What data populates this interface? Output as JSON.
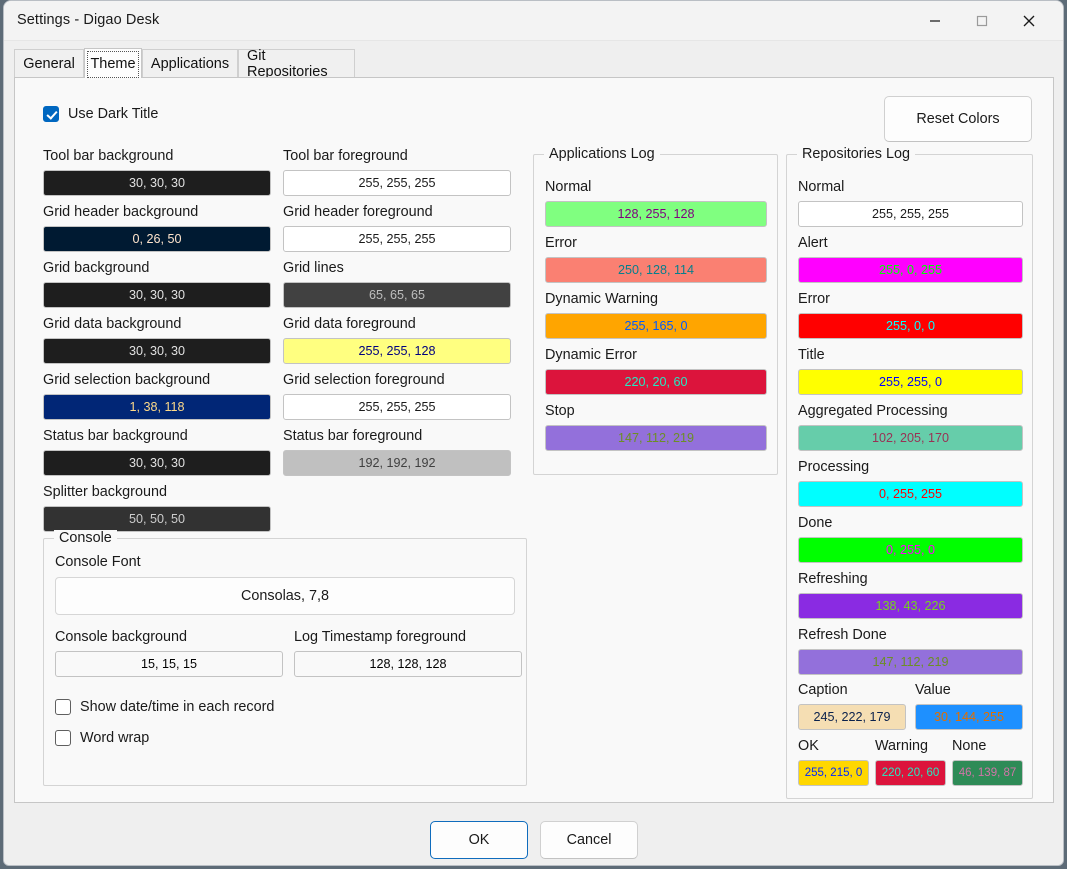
{
  "window": {
    "title": "Settings - Digao Desk",
    "controls": {
      "minimize": "minimize-icon",
      "maximize": "maximize-icon",
      "close": "close-icon"
    }
  },
  "tabs": [
    {
      "label": "General",
      "selected": false
    },
    {
      "label": "Theme",
      "selected": true
    },
    {
      "label": "Applications",
      "selected": false
    },
    {
      "label": "Git Repositories",
      "selected": false
    }
  ],
  "theme": {
    "use_dark_title": {
      "label": "Use Dark Title",
      "checked": true
    },
    "reset_colors_button": "Reset Colors",
    "column_left": [
      {
        "label": "Tool bar background",
        "value": "30, 30, 30",
        "bg": "#1e1e1e",
        "fg": "#e1e1e1"
      },
      {
        "label": "Grid header background",
        "value": "0, 26, 50",
        "bg": "#001a32",
        "fg": "#ffe5cd"
      },
      {
        "label": "Grid background",
        "value": "30, 30, 30",
        "bg": "#1e1e1e",
        "fg": "#e1e1e1"
      },
      {
        "label": "Grid data background",
        "value": "30, 30, 30",
        "bg": "#1e1e1e",
        "fg": "#e1e1e1"
      },
      {
        "label": "Grid selection background",
        "value": "1, 38, 118",
        "bg": "#012676",
        "fg": "#fed989"
      },
      {
        "label": "Status bar background",
        "value": "30, 30, 30",
        "bg": "#1e1e1e",
        "fg": "#e1e1e1"
      },
      {
        "label": "Splitter background",
        "value": "50, 50, 50",
        "bg": "#323232",
        "fg": "#cdcdcd"
      }
    ],
    "column_right": [
      {
        "label": "Tool bar foreground",
        "value": "255, 255, 255",
        "bg": "#ffffff",
        "fg": "#1a1a1a"
      },
      {
        "label": "Grid header foreground",
        "value": "255, 255, 255",
        "bg": "#ffffff",
        "fg": "#1a1a1a"
      },
      {
        "label": "Grid lines",
        "value": "65, 65, 65",
        "bg": "#414141",
        "fg": "#bebebe"
      },
      {
        "label": "Grid data foreground",
        "value": "255, 255, 128",
        "bg": "#ffff80",
        "fg": "#00007f"
      },
      {
        "label": "Grid selection foreground",
        "value": "255, 255, 255",
        "bg": "#ffffff",
        "fg": "#1a1a1a"
      },
      {
        "label": "Status bar foreground",
        "value": "192, 192, 192",
        "bg": "#c0c0c0",
        "fg": "#3f3f3f"
      }
    ],
    "console": {
      "group_title": "Console",
      "font_label": "Console Font",
      "font_value": "Consolas, 7,8",
      "background": {
        "label": "Console background",
        "value": "15, 15, 15",
        "bg": "#0f0f0f",
        "fg": "#f0f0f0"
      },
      "timestamp": {
        "label": "Log Timestamp foreground",
        "value": "128, 128, 128",
        "bg": "#808080",
        "fg": "#7f7f7f"
      },
      "show_datetime": {
        "label": "Show date/time in each record",
        "checked": false
      },
      "word_wrap": {
        "label": "Word wrap",
        "checked": false
      }
    },
    "applications_log": {
      "group_title": "Applications Log",
      "items": [
        {
          "label": "Normal",
          "value": "128, 255, 128",
          "bg": "#80ff80",
          "fg": "#7f007f"
        },
        {
          "label": "Error",
          "value": "250, 128, 114",
          "bg": "#fa8072",
          "fg": "#057f8d"
        },
        {
          "label": "Dynamic Warning",
          "value": "255, 165, 0",
          "bg": "#ffa500",
          "fg": "#005aff"
        },
        {
          "label": "Dynamic Error",
          "value": "220, 20, 60",
          "bg": "#dc143c",
          "fg": "#23ebc3"
        },
        {
          "label": "Stop",
          "value": "147, 112, 219",
          "bg": "#9370db",
          "fg": "#6c8f24"
        }
      ]
    },
    "repositories_log": {
      "group_title": "Repositories Log",
      "items": [
        {
          "label": "Normal",
          "value": "255, 255, 255",
          "bg": "#ffffff",
          "fg": "#1a1a1a"
        },
        {
          "label": "Alert",
          "value": "255, 0, 255",
          "bg": "#ff00ff",
          "fg": "#00ff00"
        },
        {
          "label": "Error",
          "value": "255, 0, 0",
          "bg": "#ff0000",
          "fg": "#00ffff"
        },
        {
          "label": "Title",
          "value": "255, 255, 0",
          "bg": "#ffff00",
          "fg": "#0000ff"
        },
        {
          "label": "Aggregated Processing",
          "value": "102, 205, 170",
          "bg": "#66cdaa",
          "fg": "#993255"
        },
        {
          "label": "Processing",
          "value": "0, 255, 255",
          "bg": "#00ffff",
          "fg": "#ff0000"
        },
        {
          "label": "Done",
          "value": "0, 255, 0",
          "bg": "#00ff00",
          "fg": "#ff00ff"
        },
        {
          "label": "Refreshing",
          "value": "138, 43, 226",
          "bg": "#8a2be2",
          "fg": "#75d41d"
        },
        {
          "label": "Refresh Done",
          "value": "147, 112, 219",
          "bg": "#9370db",
          "fg": "#6c8f24"
        }
      ],
      "pairs": [
        {
          "label": "Caption",
          "value": "245, 222, 179",
          "bg": "#f5deb3",
          "fg": "#0a214c"
        },
        {
          "label": "Value",
          "value": "30, 144, 255",
          "bg": "#1e90ff",
          "fg": "#e16f00"
        }
      ],
      "triple": [
        {
          "label": "OK",
          "value": "255, 215, 0",
          "bg": "#ffd700",
          "fg": "#0028ff"
        },
        {
          "label": "Warning",
          "value": "220, 20, 60",
          "bg": "#dc143c",
          "fg": "#23ebc3"
        },
        {
          "label": "None",
          "value": "46, 139, 87",
          "bg": "#2e8b57",
          "fg": "#d174a8"
        }
      ]
    }
  },
  "footer": {
    "ok": "OK",
    "cancel": "Cancel"
  }
}
